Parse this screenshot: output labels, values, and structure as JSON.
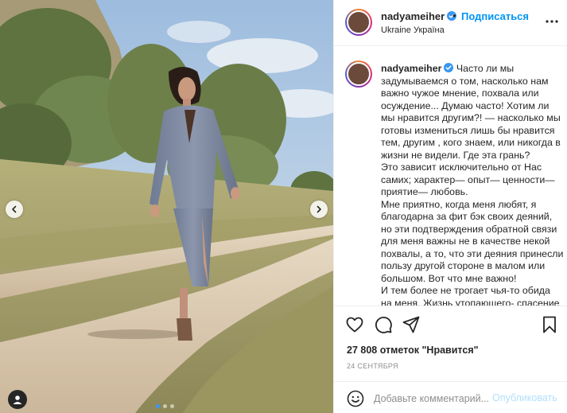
{
  "post": {
    "username": "nadyameiher",
    "follow_dot": "•",
    "follow_label": "Подписаться",
    "location": "Ukraine Україна",
    "caption_username": "nadyameiher",
    "caption": "Часто ли мы задумываемся о том, насколько нам важно чужое мнение, похвала или осуждение... Думаю часто! Хотим ли мы нравится другим?! — насколько мы готовы измениться лишь бы нравится тем, другим , кого знаем, или никогда в жизни не видели. Где эта грань?\nЭто зависит исключительно от Нас самих; характер— опыт— ценности— приятие— любовь.\nМне приятно, когда меня любят, я благодарна за фит бэк своих деяний, но эти подтверждения обратной связи для меня важны не в качестве некой похвалы, а то, что эти деяния принесли пользу другой стороне в малом или большом. Вот что мне важно!\nИ тем более не трогает чья-то обида на меня. Жизнь утопающего- спасение",
    "likes": "27 808 отметок \"Нравится\"",
    "date": "24 СЕНТЯБРЯ",
    "comment_placeholder": "Добавьте комментарий...",
    "publish_label": "Опубликовать"
  },
  "carousel": {
    "slide_count": 3,
    "active_index": 0
  },
  "icons": {
    "verified": "verified-badge-icon",
    "more": "more-options-icon",
    "like": "heart-icon",
    "comment": "comment-bubble-icon",
    "share": "paper-plane-icon",
    "save": "bookmark-icon",
    "emoji": "emoji-icon",
    "prev": "chevron-left-icon",
    "next": "chevron-right-icon",
    "tags": "user-tag-icon"
  },
  "colors": {
    "accent": "#0095f6",
    "publish_disabled": "#b2dffc",
    "verified": "#3897f0",
    "text": "#262626",
    "muted": "#8e8e8e",
    "border": "#efefef"
  }
}
